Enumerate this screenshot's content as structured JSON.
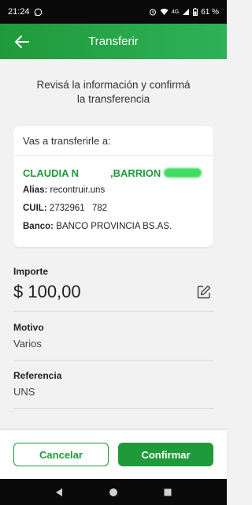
{
  "status_bar": {
    "time": "21:24",
    "network": "4G",
    "battery": "61 %"
  },
  "header": {
    "title": "Transferir"
  },
  "intro_text": "Revisá la información y confirmá la transferencia",
  "recipient_card": {
    "header": "Vas a transferirle a:",
    "name_first": "CLAUDIA N",
    "name_last": ",BARRION",
    "alias_label": "Alias:",
    "alias_value": "recontruir.uns",
    "cuil_label": "CUIL:",
    "cuil_value_a": "2732961",
    "cuil_value_b": "782",
    "bank_label": "Banco:",
    "bank_value": "BANCO PROVINCIA BS.AS."
  },
  "importe": {
    "label": "Importe",
    "value": "$ 100,00"
  },
  "motivo": {
    "label": "Motivo",
    "value": "Varios"
  },
  "referencia": {
    "label": "Referencia",
    "value": "UNS"
  },
  "actions": {
    "cancel_label": "Cancelar",
    "confirm_label": "Confirmar"
  },
  "colors": {
    "brand_green": "#1f9a3a",
    "header_gradient_end": "#2fb15a"
  }
}
